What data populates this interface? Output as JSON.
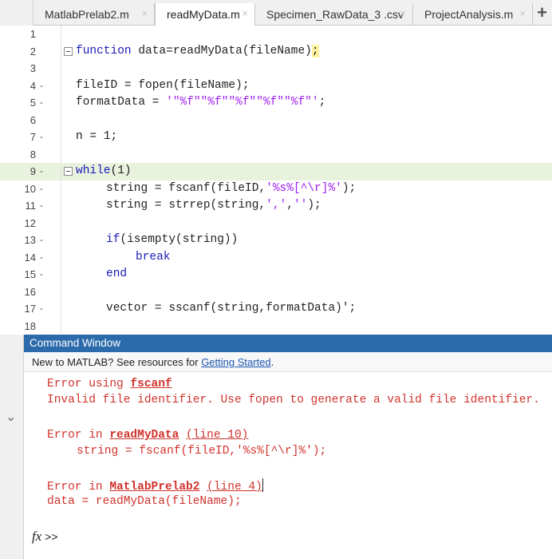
{
  "tabs": [
    {
      "label": "MatlabPrelab2.m",
      "active": false
    },
    {
      "label": "readMyData.m",
      "active": true
    },
    {
      "label": "Specimen_RawData_3 .csv",
      "active": false
    },
    {
      "label": "ProjectAnalysis.m",
      "active": false
    }
  ],
  "tab_close_glyph": "×",
  "tab_add_glyph": "+",
  "editor": {
    "lines": [
      {
        "num": "1",
        "dash": ""
      },
      {
        "num": "2",
        "dash": ""
      },
      {
        "num": "3",
        "dash": ""
      },
      {
        "num": "4",
        "dash": "-"
      },
      {
        "num": "5",
        "dash": "-"
      },
      {
        "num": "6",
        "dash": ""
      },
      {
        "num": "7",
        "dash": "-"
      },
      {
        "num": "8",
        "dash": ""
      },
      {
        "num": "9",
        "dash": "-"
      },
      {
        "num": "10",
        "dash": "-"
      },
      {
        "num": "11",
        "dash": "-"
      },
      {
        "num": "12",
        "dash": ""
      },
      {
        "num": "13",
        "dash": "-"
      },
      {
        "num": "14",
        "dash": "-"
      },
      {
        "num": "15",
        "dash": "-"
      },
      {
        "num": "16",
        "dash": ""
      },
      {
        "num": "17",
        "dash": "-"
      },
      {
        "num": "18",
        "dash": ""
      }
    ],
    "code": {
      "l2_kw": "function",
      "l2_rest": " data=readMyData(fileName)",
      "l2_semi": ";",
      "l4": "fileID = fopen(fileName);",
      "l5_a": "formatData = ",
      "l5_str": "'\"%f\"\"%f\"\"%f\"\"%f\"\"%f\"'",
      "l5_b": ";",
      "l7": "n = 1;",
      "l9_kw": "while",
      "l9_rest": "(1)",
      "l10_a": "string = fscanf(fileID,",
      "l10_str": "'%s%[^\\r]%'",
      "l10_b": ");",
      "l11_a": "string = strrep(string,",
      "l11_str1": "','",
      "l11_c": ",",
      "l11_str2": "''",
      "l11_b": ");",
      "l13_kw": "if",
      "l13_rest": "(isempty(string))",
      "l14_kw": "break",
      "l15_kw": "end",
      "l17": "vector = sscanf(string,formatData)';"
    }
  },
  "command_window": {
    "title": "Command Window",
    "notice_text": "New to MATLAB? See resources for ",
    "notice_link": "Getting Started",
    "notice_end": ".",
    "err1_a": "Error using ",
    "err1_fn": "fscanf",
    "err1_msg": "Invalid file identifier. Use fopen to generate a valid file identifier.",
    "err2_a": "Error in ",
    "err2_fn": "readMyData",
    "err2_b": " ",
    "err2_line": "(line 10)",
    "err2_code_a": "string = fscanf(fileID,",
    "err2_code_str": "'%s%[^\\r]%'",
    "err2_code_b": ");",
    "err3_a": "Error in ",
    "err3_fn": "MatlabPrelab2",
    "err3_b": " ",
    "err3_line": "(line 4)",
    "err3_code": "data = readMyData(fileName);",
    "prompt_fx": "fx",
    "prompt": ">>"
  },
  "colors": {
    "keyword": "#1a1ab8",
    "string": "#a020f0",
    "error": "#d0332d",
    "cw_title_bg": "#2b6bab",
    "highlight_line": "#e9f2dd"
  }
}
